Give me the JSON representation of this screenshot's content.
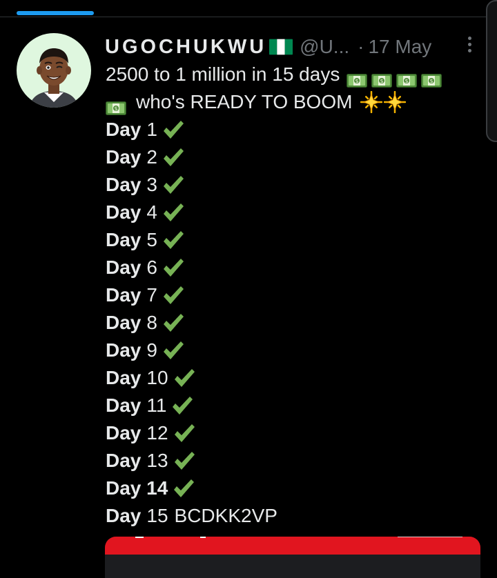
{
  "tweet": {
    "author": {
      "display_name": "UGOCHUKWU",
      "handle": "@U...",
      "flag_icon": "nigeria-flag-icon",
      "flag_colors": [
        "#008751",
        "#ffffff",
        "#008751"
      ]
    },
    "separator": "·",
    "date": "17 May",
    "text": {
      "line1": "2500 to 1 million in 15 days",
      "line2": "who's READY TO BOOM",
      "money_icon": "money-bill-icon",
      "sparkle_icon": "glowing-star-icon",
      "check_icon": "check-mark-icon",
      "check_color": "#77b255"
    },
    "days": [
      {
        "label": "Day",
        "num": "1",
        "checked": true,
        "extra": ""
      },
      {
        "label": "Day",
        "num": "2",
        "checked": true,
        "extra": ""
      },
      {
        "label": "Day",
        "num": "3",
        "checked": true,
        "extra": ""
      },
      {
        "label": "Day",
        "num": "4",
        "checked": true,
        "extra": ""
      },
      {
        "label": "Day",
        "num": "5",
        "checked": true,
        "extra": ""
      },
      {
        "label": "Day",
        "num": "6",
        "checked": true,
        "extra": ""
      },
      {
        "label": "Day",
        "num": "7",
        "checked": true,
        "extra": ""
      },
      {
        "label": "Day",
        "num": "8",
        "checked": true,
        "extra": ""
      },
      {
        "label": "Day",
        "num": "9",
        "checked": true,
        "extra": ""
      },
      {
        "label": "Day",
        "num": "10",
        "checked": true,
        "extra": ""
      },
      {
        "label": "Day",
        "num": "11",
        "checked": true,
        "extra": ""
      },
      {
        "label": "Day",
        "num": "12",
        "checked": true,
        "extra": ""
      },
      {
        "label": "Day",
        "num": "13",
        "checked": true,
        "extra": ""
      },
      {
        "label": "Day 14",
        "num": "",
        "checked": true,
        "extra": ""
      },
      {
        "label": "Day",
        "num": "15",
        "checked": false,
        "extra": "BCDKK2VP"
      }
    ]
  },
  "colors": {
    "background": "#000000",
    "text": "#e7e9ea",
    "muted": "#71767b",
    "accent": "#1d9bf0",
    "media_red": "#e1151f"
  }
}
